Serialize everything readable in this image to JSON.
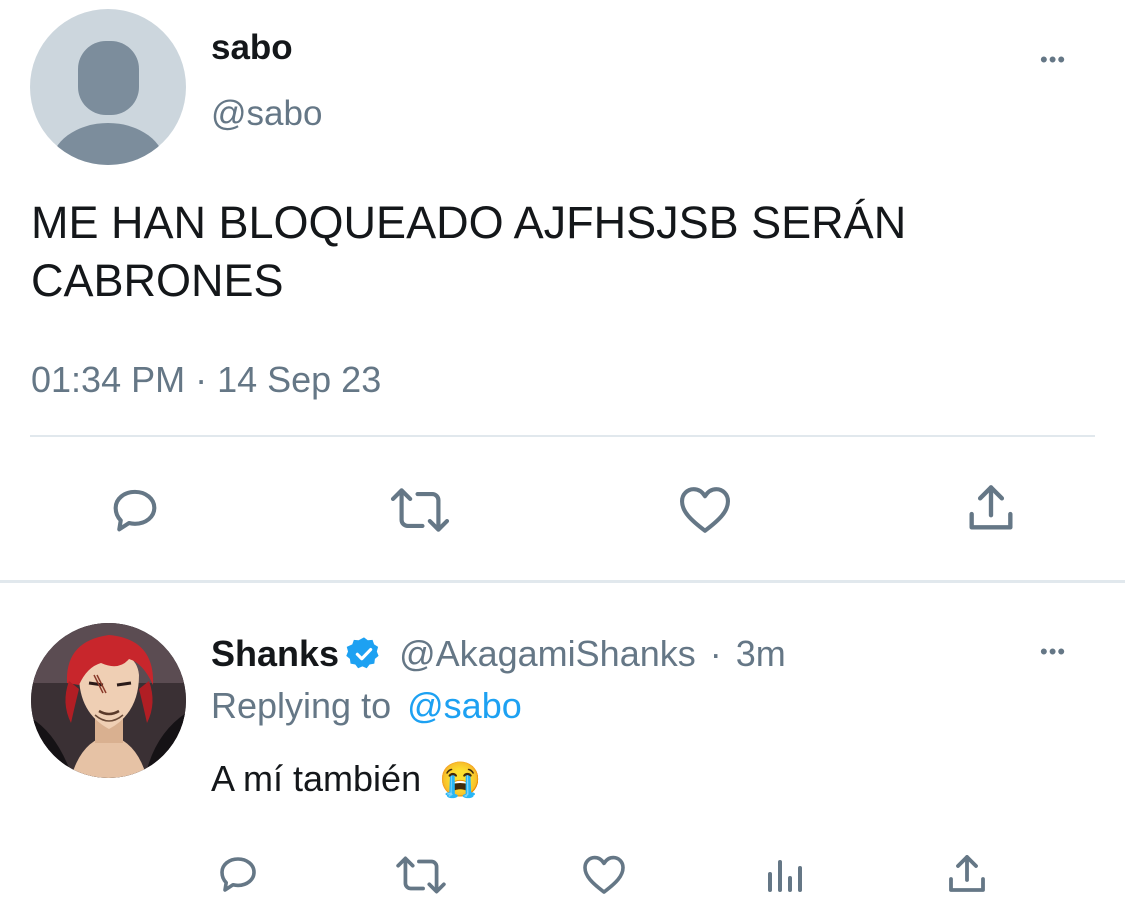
{
  "main_tweet": {
    "display_name": "sabo",
    "handle": "@sabo",
    "text": "ME HAN BLOQUEADO AJFHSJSB SERÁN CABRONES",
    "timestamp": "01:34 PM · 14 Sep 23",
    "more_label": "•••",
    "actions": [
      "reply-icon",
      "retweet-icon",
      "like-icon",
      "share-icon"
    ]
  },
  "reply_tweet": {
    "display_name": "Shanks",
    "verified": true,
    "handle": "@AkagamiShanks",
    "separator": "·",
    "age": "3m",
    "replying_prefix": "Replying to",
    "replying_to": "@sabo",
    "text": "A mí también",
    "emoji": "😭",
    "more_label": "•••",
    "actions": [
      "reply-icon",
      "retweet-icon",
      "like-icon",
      "analytics-icon",
      "share-icon"
    ]
  },
  "colors": {
    "text": "#14171a",
    "secondary": "#657786",
    "accent": "#1da1f2",
    "divider": "#e1e8ed",
    "avatar_placeholder": "#ccd6dd",
    "avatar_silhouette": "#7c8d9c"
  }
}
